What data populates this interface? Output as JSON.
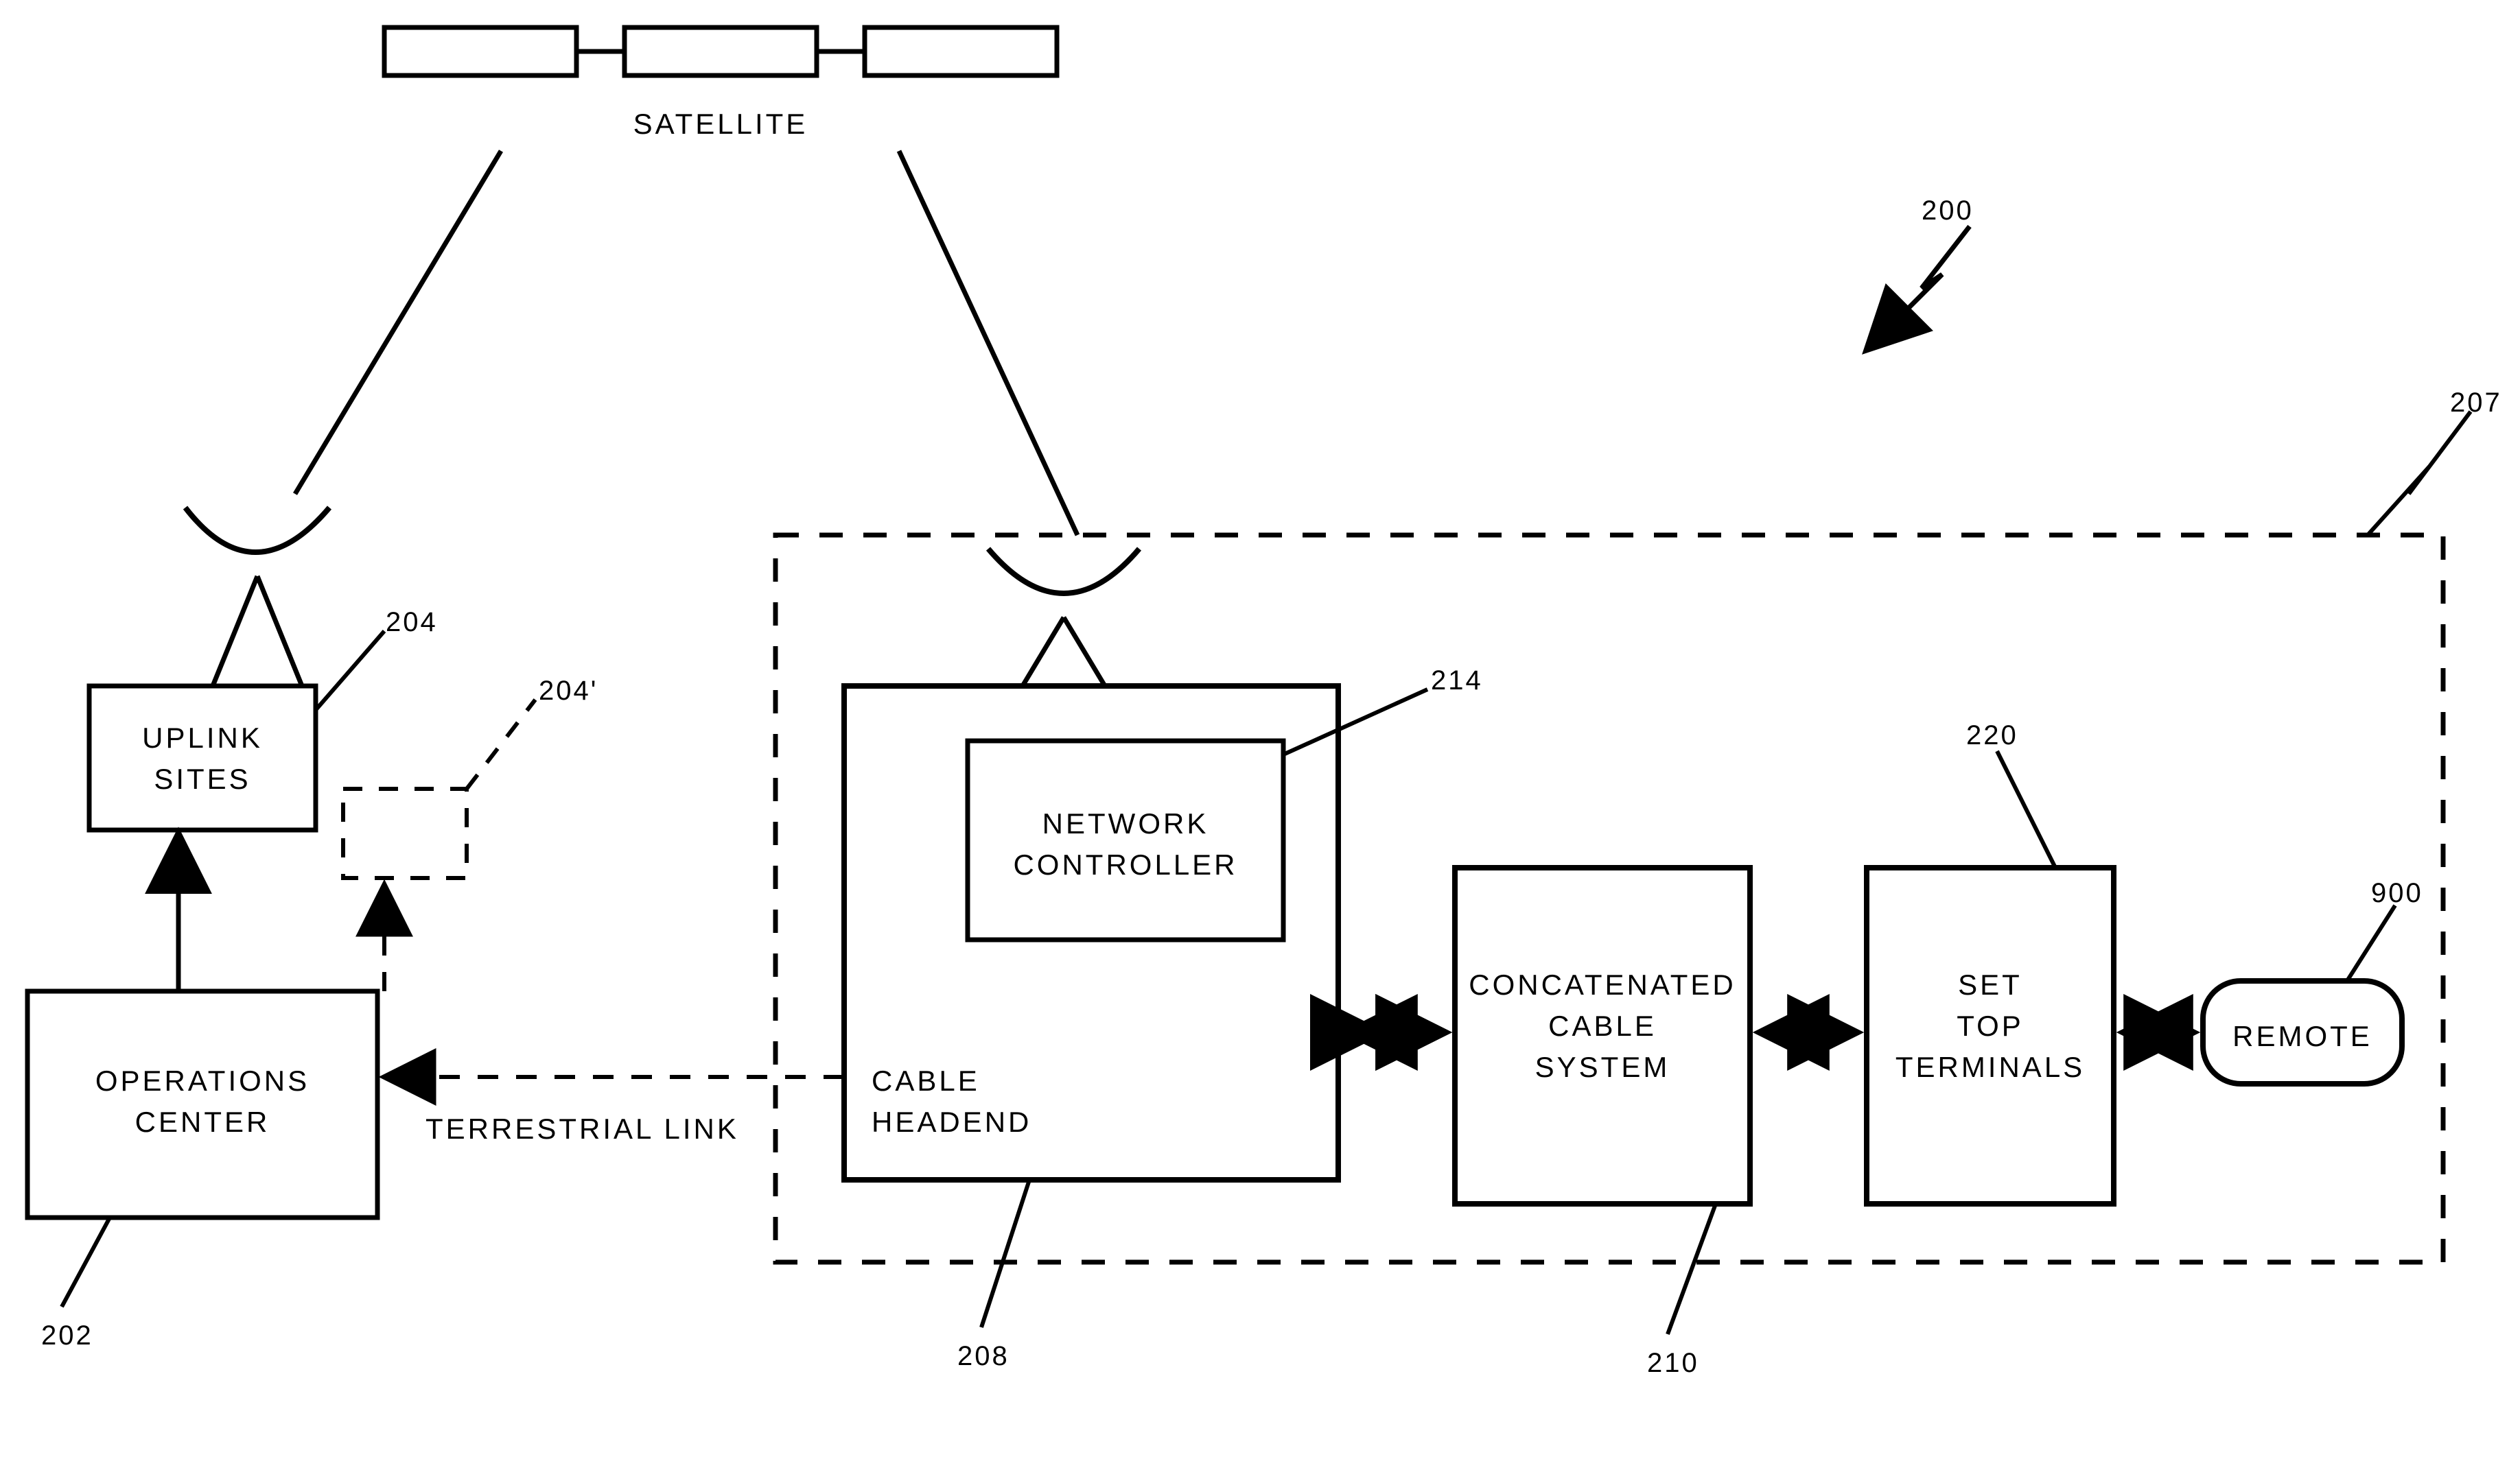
{
  "labels": {
    "satellite": "SATELLITE",
    "uplink1": "UPLINK",
    "uplink2": "SITES",
    "opcenter1": "OPERATIONS",
    "opcenter2": "CENTER",
    "terrestrial": "TERRESTRIAL   LINK",
    "netctrl1": "NETWORK",
    "netctrl2": "CONTROLLER",
    "cablehead1": "CABLE",
    "cablehead2": "HEADEND",
    "concat1": "CONCATENATED",
    "concat2": "CABLE",
    "concat3": "SYSTEM",
    "stt1": "SET",
    "stt2": "TOP",
    "stt3": "TERMINALS",
    "remote": "REMOTE"
  },
  "refnums": {
    "r200": "200",
    "r207": "207",
    "r204": "204",
    "r204p": "204'",
    "r202": "202",
    "r208": "208",
    "r214": "214",
    "r210": "210",
    "r220": "220",
    "r900": "900"
  }
}
